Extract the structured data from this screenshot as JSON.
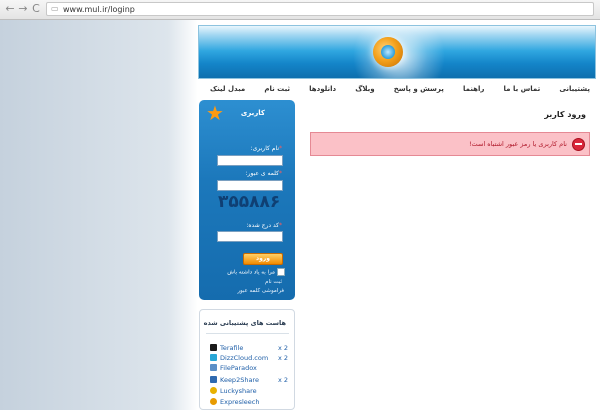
{
  "browser": {
    "back": "←",
    "forward": "→",
    "reload": "C",
    "url_icon": "page-icon",
    "url": "www.mul.ir/loginp"
  },
  "nav": {
    "items": [
      "پشتیبانی",
      "تماس با ما",
      "راهنما",
      "پرسش و پاسخ",
      "وبلاگ",
      "دانلودها",
      "ثبت نام",
      "مبدل لینک"
    ]
  },
  "main": {
    "heading": "ورود کاربر",
    "error_text": "نام کاربری یا رمز عبور اشتباه است!"
  },
  "login": {
    "title": "کاربری",
    "username_label": "نام کاربری:",
    "password_label": "کلمه ی عبور:",
    "captcha": "۳۵۵۸۸۶",
    "captcha_label": "کد درج شده:",
    "required_mark": "*",
    "submit": "ورود",
    "remember": "مرا به یاد داشته باش",
    "register": "ثبت نام",
    "forgot": "فراموشی کلمه عبور"
  },
  "hosts": {
    "title": "هاست های پشتیبانی شده",
    "items": [
      {
        "name": "Terafile",
        "count": "x 2",
        "color": "#f0a400",
        "icon": "terafile-icon"
      },
      {
        "name": "DizzCloud.com",
        "count": "x 2",
        "color": "#2aa7d6",
        "icon": "dizzcloud-icon"
      },
      {
        "name": "FileParadox",
        "count": "",
        "color": "#5b8fc7",
        "icon": "fileparadox-icon"
      },
      {
        "name": "Keep2Share",
        "count": "x 2",
        "color": "#2f6ab0",
        "icon": "keep2share-icon"
      },
      {
        "name": "Luckyshare",
        "count": "",
        "color": "#e8b100",
        "icon": "luckyshare-icon"
      },
      {
        "name": "Expresleech",
        "count": "",
        "color": "#e89b00",
        "icon": "expresleech-icon"
      }
    ]
  }
}
